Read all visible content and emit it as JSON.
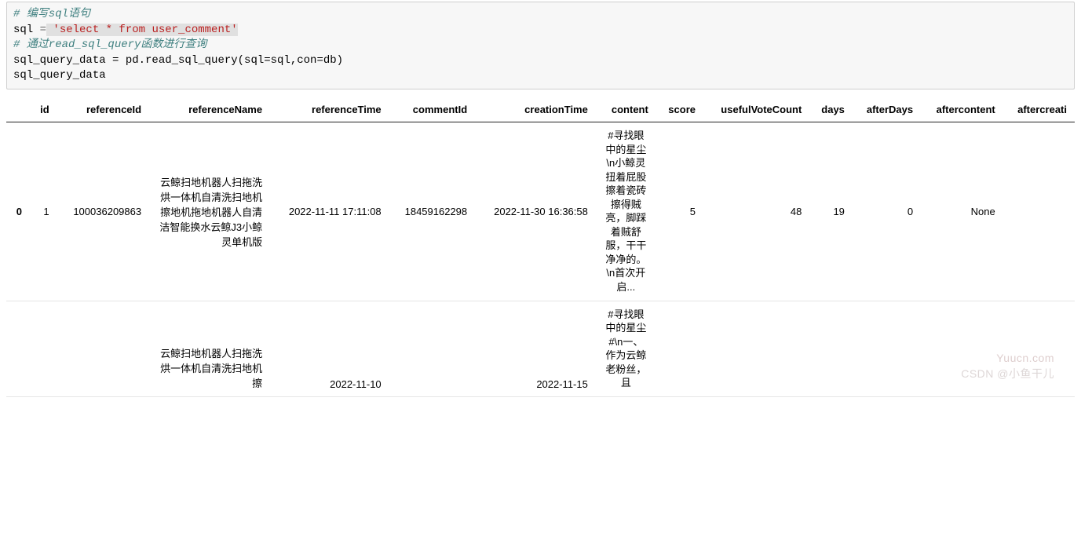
{
  "code": {
    "line1": "# 编写sql语句",
    "line2_var": "sql ",
    "line2_eq": "=",
    "line2_str": " 'select * from user_comment'",
    "line3": "# 通过read_sql_query函数进行查询",
    "line4": "sql_query_data = pd.read_sql_query(sql=sql,con=db)",
    "line5": "sql_query_data"
  },
  "columns": [
    "",
    "id",
    "referenceId",
    "referenceName",
    "referenceTime",
    "commentId",
    "creationTime",
    "content",
    "score",
    "usefulVoteCount",
    "days",
    "afterDays",
    "aftercontent",
    "aftercreati"
  ],
  "rows": [
    {
      "index": "0",
      "id": "1",
      "referenceId": "100036209863",
      "referenceName": "云鲸扫地机器人扫拖洗烘一体机自清洗扫地机擦地机拖地机器人自清洁智能换水云鲸J3小鲸灵单机版",
      "referenceTime": "2022-11-11 17:11:08",
      "commentId": "18459162298",
      "creationTime": "2022-11-30 16:36:58",
      "content": "#寻找眼中的星尘 \\n小鲸灵扭着屁股擦着瓷砖擦得贼亮，脚踩着贼舒服，干干净净的。\\n首次开启...",
      "score": "5",
      "usefulVoteCount": "48",
      "days": "19",
      "afterDays": "0",
      "aftercontent": "None",
      "aftercreati": ""
    },
    {
      "index": "",
      "id": "",
      "referenceId": "",
      "referenceName": "云鲸扫地机器人扫拖洗烘一体机自清洗扫地机擦",
      "referenceTime": "2022-11-10",
      "commentId": "",
      "creationTime": "2022-11-15",
      "content": "#寻找眼中的星尘#\\n一、作为云鲸老粉丝，且",
      "score": "",
      "usefulVoteCount": "",
      "days": "",
      "afterDays": "",
      "aftercontent": "",
      "aftercreati": ""
    }
  ],
  "watermarks": {
    "w1": "Yuucn.com",
    "w2": "CSDN @小鱼干儿"
  }
}
